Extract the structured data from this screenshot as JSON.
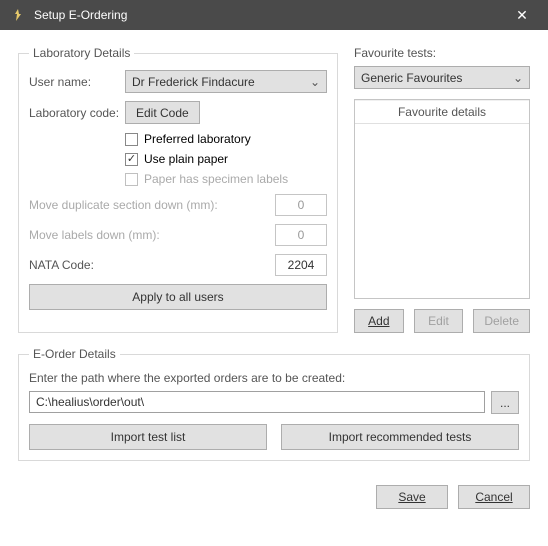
{
  "window": {
    "title": "Setup E-Ordering"
  },
  "lab": {
    "legend": "Laboratory Details",
    "user_label": "User name:",
    "user_value": "Dr Frederick Findacure",
    "code_label": "Laboratory code:",
    "edit_code": "Edit Code",
    "chk_preferred": "Preferred laboratory",
    "chk_plain": "Use plain paper",
    "chk_specimen": "Paper has specimen labels",
    "move_dup_label": "Move duplicate section down (mm):",
    "move_dup_value": "0",
    "move_labels_label": "Move labels down (mm):",
    "move_labels_value": "0",
    "nata_label": "NATA Code:",
    "nata_value": "2204",
    "apply": "Apply to all users"
  },
  "fav": {
    "legend": "Favourite tests:",
    "combo": "Generic Favourites",
    "header": "Favourite details",
    "add": "Add",
    "edit": "Edit",
    "delete": "Delete"
  },
  "eorder": {
    "legend": "E-Order Details",
    "path_label": "Enter the path where the exported orders are to be created:",
    "path_value": "C:\\healius\\order\\out\\",
    "browse": "...",
    "import_list": "Import test list",
    "import_rec": "Import recommended tests"
  },
  "footer": {
    "save": "Save",
    "cancel": "Cancel"
  }
}
